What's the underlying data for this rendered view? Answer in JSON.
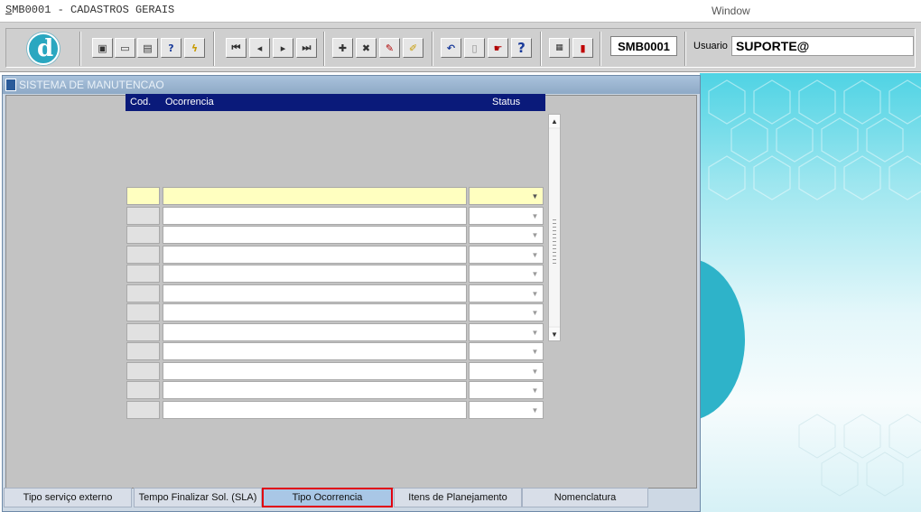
{
  "window": {
    "title_prefix": "S",
    "title_rest": "MB0001 - CADASTROS GERAIS",
    "menu_window": "Window"
  },
  "toolbar": {
    "form_code": "SMB0001",
    "user_label": "Usuario",
    "user_value": "SUPORTE@"
  },
  "form": {
    "title": "SISTEMA DE MANUTENCAO",
    "grid": {
      "columns": [
        "Cod.",
        "Ocorrencia",
        "Status"
      ],
      "row_count": 12,
      "active_row": 0
    }
  },
  "tabs": [
    {
      "label": "Tipo serviço externo",
      "selected": false
    },
    {
      "label": "Tempo Finalizar Sol. (SLA)",
      "selected": false
    },
    {
      "label": "Tipo Ocorrencia",
      "selected": true
    },
    {
      "label": "Itens de Planejamento",
      "selected": false
    },
    {
      "label": "Nomenclatura",
      "selected": false
    }
  ],
  "colors": {
    "grid_header": "#0a1a7a",
    "active_row": "#ffffc0",
    "selected_tab_border": "#e0000f",
    "accent": "#2aa7c0"
  }
}
